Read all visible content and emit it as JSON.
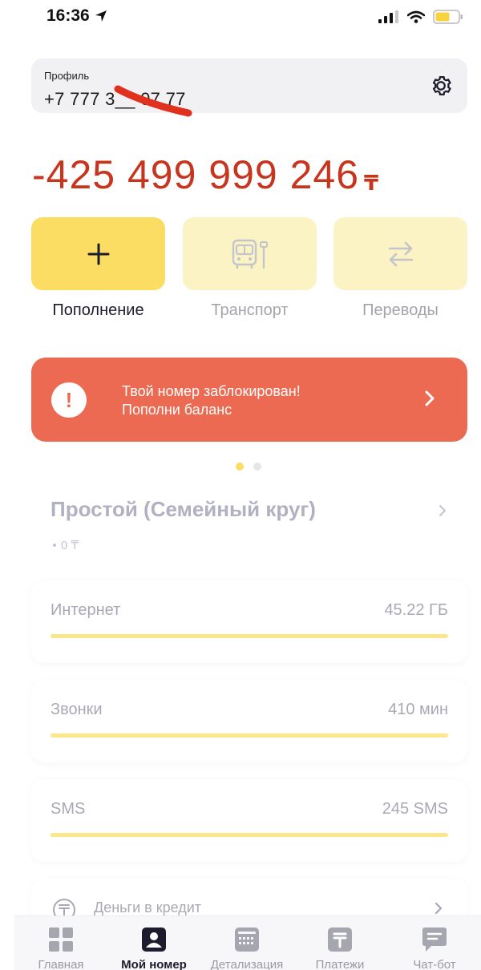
{
  "status_bar": {
    "time": "16:36"
  },
  "profile": {
    "label": "Профиль",
    "phone": "+7 777 3__ 07 77"
  },
  "balance": {
    "amount": "-425 499 999 246",
    "currency": "₸"
  },
  "actions": [
    {
      "label": "Пополнение",
      "icon": "plus-icon",
      "state": "active"
    },
    {
      "label": "Транспорт",
      "icon": "bus-icon",
      "state": "disabled"
    },
    {
      "label": "Переводы",
      "icon": "transfer-arrows-icon",
      "state": "disabled"
    }
  ],
  "alert": {
    "line1": "Твой номер заблокирован!",
    "line2": "Пополни баланс"
  },
  "pager": {
    "count": 2,
    "active_index": 0
  },
  "tariff": {
    "name": "Простой (Семейный круг)",
    "price": "0 ₸"
  },
  "usage": [
    {
      "name": "Интернет",
      "value": "45.22 ГБ",
      "fill_fraction": 1.0
    },
    {
      "name": "Звонки",
      "value": "410 мин",
      "fill_fraction": 1.0
    },
    {
      "name": "SMS",
      "value": "245 SMS",
      "fill_fraction": 1.0
    }
  ],
  "credit": {
    "label": "Деньги в кредит"
  },
  "tabs": [
    {
      "label": "Главная",
      "icon": "grid-icon",
      "active": false
    },
    {
      "label": "Мой номер",
      "icon": "person-card-icon",
      "active": true
    },
    {
      "label": "Детализация",
      "icon": "calendar-icon",
      "active": false
    },
    {
      "label": "Платежи",
      "icon": "tenge-icon",
      "active": false
    },
    {
      "label": "Чат-бот",
      "icon": "chat-icon",
      "active": false
    }
  ],
  "colors": {
    "accent_yellow": "#fbdd63",
    "muted_yellow": "#fcf3c4",
    "alert_red": "#ec6a52",
    "balance_red": "#c8351f",
    "pager_active": "#fbdd63",
    "pager_inactive": "#e6e6ea"
  }
}
